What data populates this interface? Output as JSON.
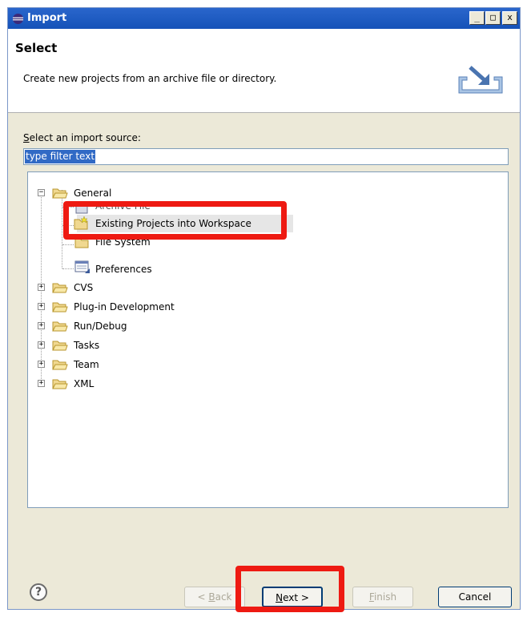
{
  "window": {
    "title": "Import",
    "buttons": {
      "minimize": "_",
      "maximize": "□",
      "close": "x"
    }
  },
  "header": {
    "title": "Select",
    "description": "Create new projects from an archive file or directory."
  },
  "source": {
    "label_prefix": "",
    "label_mnemonic": "S",
    "label_rest": "elect an import source:",
    "filter_value": "type filter text"
  },
  "tree": {
    "general": "General",
    "children": [
      "Archive File",
      "Existing Projects into Workspace",
      "File System",
      "Preferences"
    ],
    "categories": [
      "CVS",
      "Plug-in Development",
      "Run/Debug",
      "Tasks",
      "Team",
      "XML"
    ],
    "selected": "Existing Projects into Workspace"
  },
  "buttons": {
    "help": "?",
    "back_mnemonic": "B",
    "back_prefix": "< ",
    "back_rest": "ack",
    "next_mnemonic": "N",
    "next_rest": "ext >",
    "finish_mnemonic": "F",
    "finish_rest": "inish",
    "cancel": "Cancel"
  },
  "colors": {
    "highlight": "#ee1a12",
    "title_bar": "#1552b8",
    "selection": "#316ac5"
  },
  "icons": [
    "eclipse-icon",
    "import-wizard-icon",
    "folder-icon",
    "archive-file-icon",
    "project-icon",
    "file-system-icon",
    "preferences-icon",
    "help-icon"
  ]
}
